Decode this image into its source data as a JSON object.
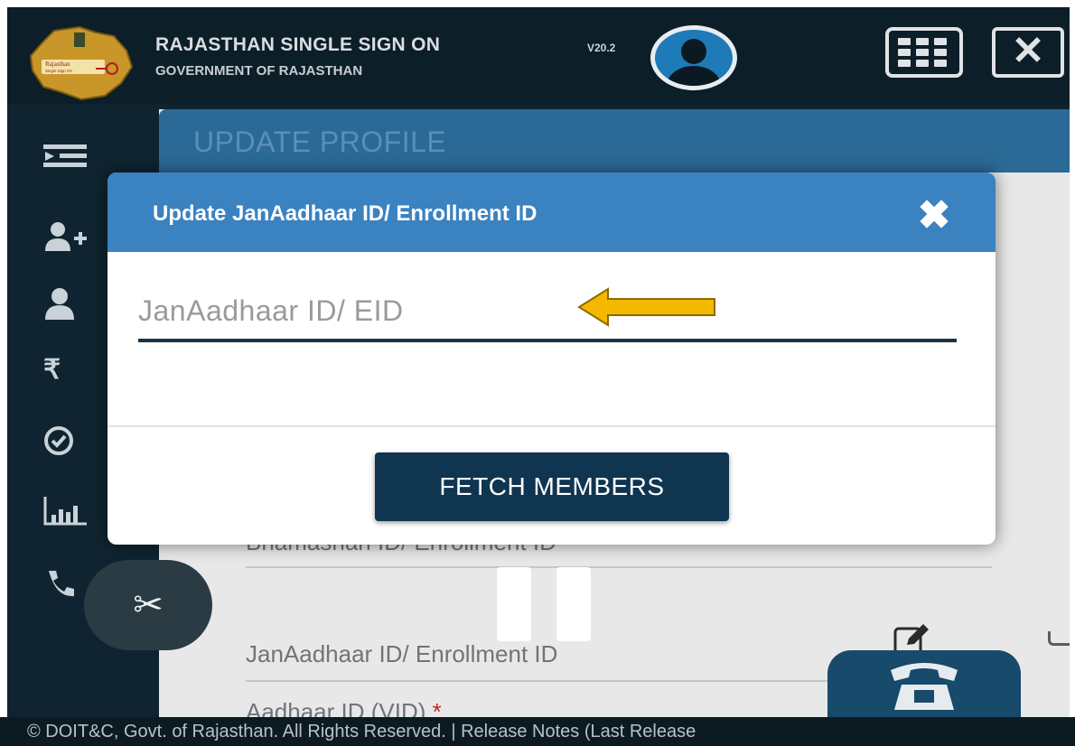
{
  "header": {
    "title": "RAJASTHAN SINGLE SIGN ON",
    "version": "V20.2",
    "subtitle": "GOVERNMENT OF RAJASTHAN",
    "logo_text_line1": "Rajasthan",
    "logo_text_line2": "Single Sign On"
  },
  "sidebar": {
    "items": [
      {
        "icon": "menu-indent-icon"
      },
      {
        "icon": "add-user-icon"
      },
      {
        "icon": "user-icon"
      },
      {
        "icon": "rupee-icon"
      },
      {
        "icon": "check-circle-icon"
      },
      {
        "icon": "bar-chart-icon"
      },
      {
        "icon": "phone-icon"
      }
    ]
  },
  "panel": {
    "title": "UPDATE PROFILE",
    "fields": [
      {
        "label": "Bhamashah ID/ Enrollment ID"
      },
      {
        "label": "JanAadhaar ID/ Enrollment ID"
      },
      {
        "label": "Aadhaar ID (VID)",
        "required_mark": "*"
      }
    ]
  },
  "modal": {
    "title": "Update JanAadhaar ID/ Enrollment ID",
    "input_placeholder": "JanAadhaar ID/ EID",
    "input_value": "",
    "fetch_label": "FETCH MEMBERS"
  },
  "footer": {
    "text": "© DOIT&C, Govt. of Rajasthan. All Rights Reserved.  |  Release Notes (Last Release"
  },
  "colors": {
    "header_bg": "#0c1e28",
    "modal_header": "#3b82c0",
    "fetch_button": "#0f3550",
    "arrow": "#f5b800"
  }
}
